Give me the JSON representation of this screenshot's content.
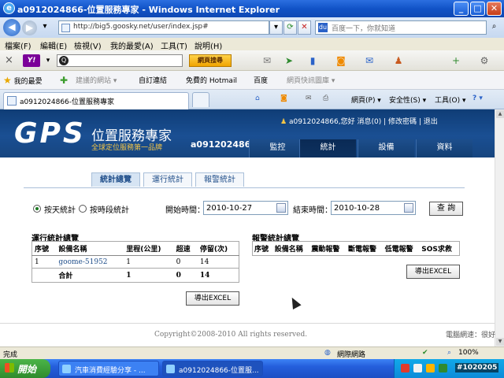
{
  "window": {
    "title": "a0912024866-位置服務專家 - Windows Internet Explorer",
    "btn_min": "_",
    "btn_max": "□",
    "btn_close": "✕"
  },
  "address": {
    "url": "http://big5.goosky.net/user/index.jsp#",
    "search_placeholder": "百度一下，你就知道"
  },
  "menu": {
    "file": "檔案(F)",
    "edit": "編輯(E)",
    "view": "檢視(V)",
    "favorites": "我的最愛(A)",
    "tools": "工具(T)",
    "help": "說明(H)"
  },
  "yahoo_bar": {
    "logo": "Y!",
    "search_button": "網頁搜尋"
  },
  "favorites_bar": {
    "favorites_label": "我的最愛",
    "items": [
      "建議的網站 ▾",
      "自訂連結",
      "免費的 Hotmail",
      "百度",
      "網頁快訊圖庫 ▾"
    ]
  },
  "tab_row": {
    "tab_title": "a0912024866-位置服務專家",
    "page_menu": "網頁(P) ▾",
    "safety_menu": "安全性(S) ▾",
    "tools_menu": "工具(O) ▾",
    "help_menu": "? ▾"
  },
  "site_header": {
    "logo": "GPS",
    "title": "位置服務專家",
    "subtitle": "全球定位服務第一品牌",
    "account": "a0912024866",
    "greeting": "a0912024866,您好",
    "messages": "消息(0)",
    "change_password": "修改密碼",
    "logout": "退出",
    "nav": [
      "監控",
      "統計",
      "設備",
      "資料"
    ],
    "nav_active": "統計"
  },
  "subtabs": {
    "items": [
      "統計總覽",
      "運行統計",
      "報警統計"
    ],
    "active": "統計總覽"
  },
  "filter": {
    "by_day": "按天統計",
    "by_period": "按時段統計",
    "start_label": "開始時間：",
    "start_value": "2010-10-27",
    "end_label": "結束時間：",
    "end_value": "2010-10-28",
    "query_button": "查 詢"
  },
  "run_stats": {
    "title": "運行統計總覽",
    "columns": [
      "序號",
      "設備名稱",
      "里程(公里)",
      "超速",
      "停留(次)"
    ],
    "rows": [
      [
        "1",
        "goome-51952",
        "1",
        "0",
        "14"
      ],
      [
        "",
        "合計",
        "1",
        "0",
        "14"
      ]
    ],
    "export_button": "導出EXCEL"
  },
  "alarm_stats": {
    "title": "報警統計總覽",
    "columns": [
      "序號",
      "設備名稱",
      "震動報警",
      "斷電報警",
      "低電報警",
      "SOS求救"
    ],
    "export_button": "導出EXCEL"
  },
  "footer": {
    "copyright": "Copyright©2008-2010 All rights reserved.",
    "net_speed": "電腦網速：很好"
  },
  "status_bar": {
    "status": "完成",
    "zone": "網際網路",
    "zoom": "100%"
  },
  "taskbar": {
    "start": "開始",
    "items": [
      "汽車消費經驗分享 - ...",
      "a0912024866-位置服..."
    ],
    "watermark": "#1020205"
  }
}
